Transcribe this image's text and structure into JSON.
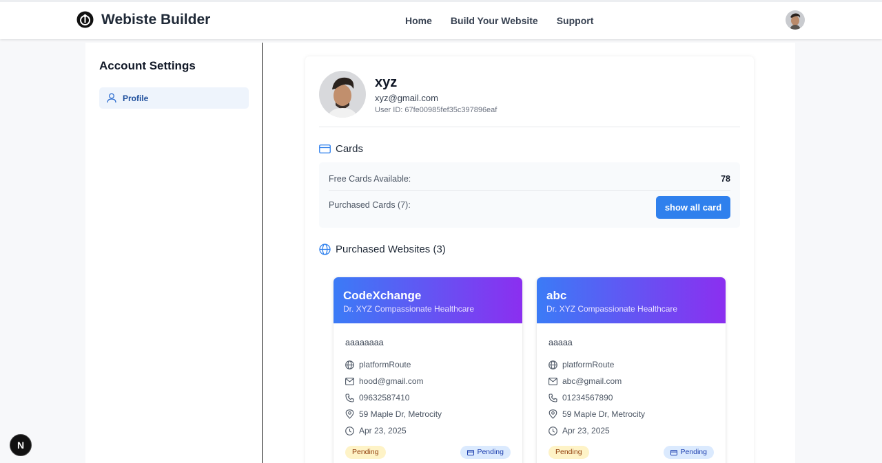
{
  "header": {
    "brand": "Webiste Builder",
    "nav": [
      "Home",
      "Build Your Website",
      "Support"
    ]
  },
  "sidebar": {
    "title": "Account Settings",
    "items": [
      {
        "label": "Profile",
        "icon": "user-icon"
      }
    ]
  },
  "profile": {
    "name": "xyz",
    "email": "xyz@gmail.com",
    "user_id": "User ID: 67fe00985fef35c397896eaf"
  },
  "cards": {
    "heading": "Cards",
    "free_label": "Free Cards Available:",
    "free_value": "78",
    "purchased_label": "Purchased Cards (7):",
    "button": "show all card"
  },
  "websites": {
    "heading": "Purchased Websites (3)",
    "items": [
      {
        "title": "CodeXchange",
        "subtitle": "Dr. XYZ Compassionate Healthcare",
        "description": "aaaaaaaa",
        "route": "platformRoute",
        "email": "hood@gmail.com",
        "phone": "09632587410",
        "address": "59 Maple Dr, Metrocity",
        "date": "Apr 23, 2025",
        "status": "Pending",
        "card_status": "Pending"
      },
      {
        "title": "abc",
        "subtitle": "Dr. XYZ Compassionate Healthcare",
        "description": "aaaaa",
        "route": "platformRoute",
        "email": "abc@gmail.com",
        "phone": "01234567890",
        "address": "59 Maple Dr, Metrocity",
        "date": "Apr 23, 2025",
        "status": "Pending",
        "card_status": "Pending"
      }
    ]
  },
  "dev_badge": "N",
  "colors": {
    "primary": "#2f80ed",
    "gradient_start": "#3b7bf6",
    "gradient_end": "#8b2ff0",
    "pending_bg": "#fef3c7",
    "card_pending_bg": "#dbeafe"
  }
}
